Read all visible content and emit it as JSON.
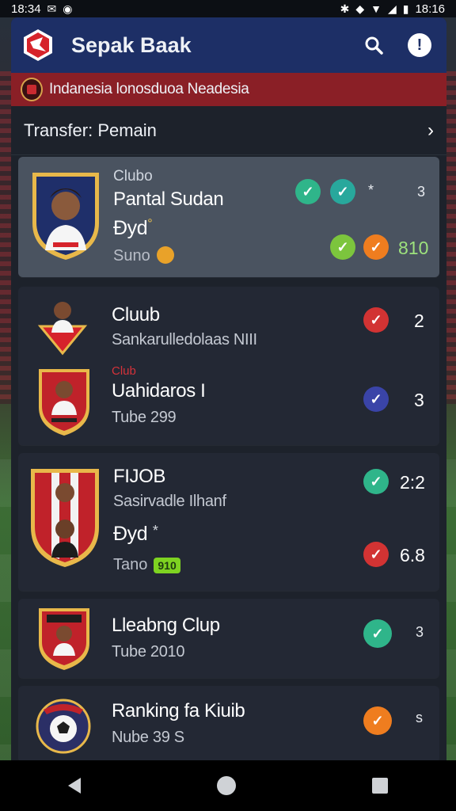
{
  "status": {
    "time": "18:34",
    "right_time": "18:16"
  },
  "app": {
    "title": "Sepak Baak",
    "league": "Indanesia lonosduoa Neadesia",
    "section": "Transfer: Pemain"
  },
  "card1": {
    "label": "Clubo",
    "title": "Pantal Sudan",
    "sub": "Ðyd",
    "star": "°",
    "footer": "Suno",
    "mark1": "*",
    "mark2": "3",
    "score": "810"
  },
  "card2": {
    "row1": {
      "title": "Cluub",
      "sub": "Sankarulledolaas NIII",
      "score": "2"
    },
    "row2": {
      "red_label": "Club",
      "title": "Uahidaros I",
      "sub": "Tube 299",
      "score": "3"
    }
  },
  "card3": {
    "title": "FIJOB",
    "sub": "Sasirvadle Ilhanf",
    "sub2": "Ðyd",
    "star": "*",
    "footer": "Tano",
    "tag": "910",
    "score1": "2:2",
    "score2": "6.8"
  },
  "card4": {
    "title": "Lleabng Clup",
    "sub": "Tube 2010",
    "score": "3"
  },
  "card5": {
    "title": "Ranking fa Kiuib",
    "sub": "Nube 39 S",
    "score": "s"
  },
  "colors": {
    "appbar": "#1d2f66",
    "league": "#8a1f26",
    "check_green": "#2fb58a",
    "check_red": "#d23333",
    "check_orange": "#ef7d1f",
    "check_blue": "#3a44a8"
  }
}
